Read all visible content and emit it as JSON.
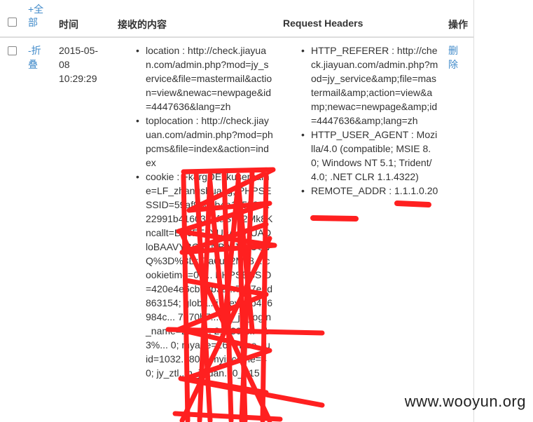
{
  "table": {
    "header": {
      "expand_all": "+全部",
      "time": "时间",
      "content": "接收的内容",
      "request_headers": "Request Headers",
      "actions": "操作"
    },
    "row": {
      "collapse": "-折叠",
      "time": "2015-05-08 10:29:29",
      "content_items": [
        "location : http://check.jiayuan.com/admin.php?mod=jy_service&file=mastermail&action=view&newac=newpage&id=4447636&lang=zh",
        "toplocation : http://check.jiayuan.com/admin.php?mod=phpcms&file=index&action=index",
        "cookie : Fk4rgOEltkusername=LF_zhangshuang; PHPSESSID=59af96c6b4a135589a22991b4160385faSu92Mk8Kncallt=BF0FT1XU0AAVIUADloBAAVYBCgENBAtJVJUOVQ%3D%3D; Da6u92Mk8... cookietime=0; ... PHPSESSID=420e4e6cbb0b3a...7cc7e5d863154; globa...i_hey=bb486984c... 7070b7...ate_jy_login_name=2899... 215309... =13%... 0; myage=26; myse...u id=1032...80... myincome=40; jy_ztl...n_jiadan...0_215"
      ],
      "header_items": [
        "HTTP_REFERER : http://check.jiayuan.com/admin.php?mod=jy_service&amp;file=mastermail&amp;action=view&amp;newac=newpage&amp;id=4447636&amp;lang=zh",
        "HTTP_USER_AGENT : Mozilla/4.0 (compatible; MSIE 8.0; Windows NT 5.1; Trident/4.0; .NET CLR 1.1.4322)",
        "REMOTE_ADDR : 1.1.1.0.20"
      ],
      "delete": "删除"
    }
  },
  "watermark": "www.wooyun.org",
  "colors": {
    "link": "#428bca",
    "redaction": "#ff2020",
    "border": "#dddddd"
  }
}
